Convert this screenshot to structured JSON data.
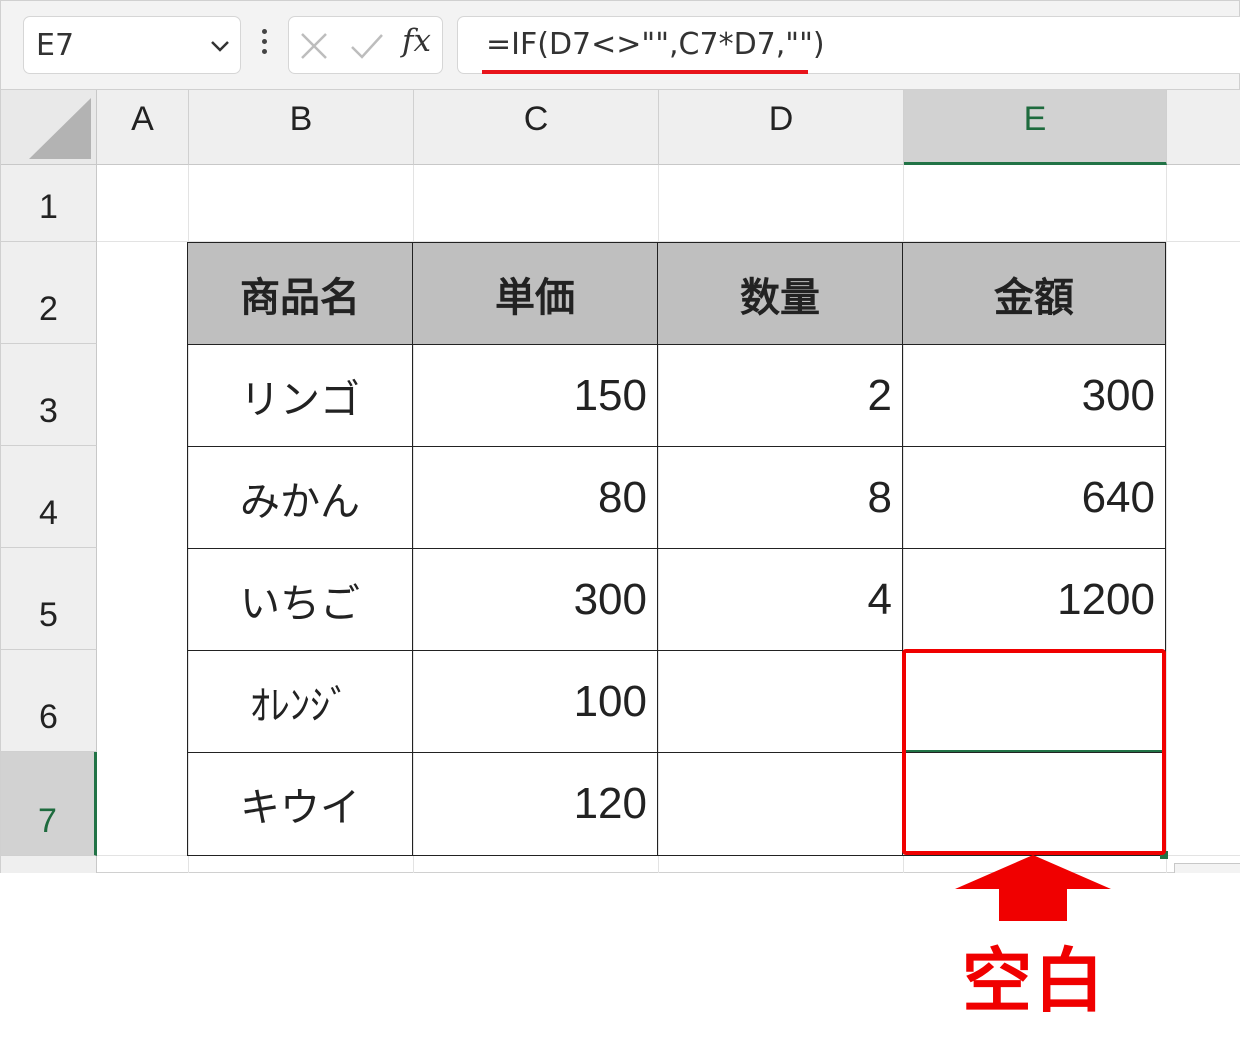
{
  "formula_bar": {
    "name_box": "E7",
    "formula": "=IF(D7<>\"\",C7*D7,\"\")",
    "icons": [
      "chevron-down-icon",
      "more-vertical-icon",
      "cancel-icon",
      "enter-check-icon",
      "fx-icon"
    ],
    "fx_label": "fx"
  },
  "grid": {
    "columns": [
      "A",
      "B",
      "C",
      "D",
      "E"
    ],
    "rows": [
      "1",
      "2",
      "3",
      "4",
      "5",
      "6",
      "7"
    ],
    "selected_cell": "E7"
  },
  "table": {
    "headers": [
      "商品名",
      "単価",
      "数量",
      "金額"
    ],
    "rows": [
      [
        "リンゴ",
        "150",
        "2",
        "300"
      ],
      [
        "みかん",
        "80",
        "8",
        "640"
      ],
      [
        "いちご",
        "300",
        "4",
        "1200"
      ],
      [
        "ｵﾚﾝｼﾞ",
        "100",
        "",
        ""
      ],
      [
        "キウイ",
        "120",
        "",
        ""
      ]
    ]
  },
  "annotation": {
    "label": "空白",
    "color": "#f00000"
  },
  "colors": {
    "accent_green": "#217346",
    "header_fill": "#bfbfbf",
    "annotation_red": "#f00000"
  }
}
